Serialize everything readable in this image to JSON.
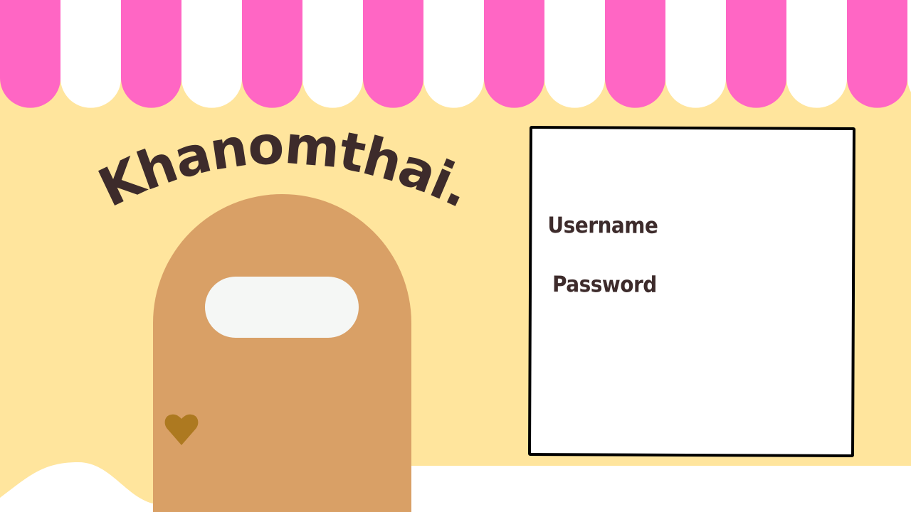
{
  "brand": {
    "title": "Khanomthai."
  },
  "login": {
    "username_label": "Username",
    "password_label": "Password"
  },
  "colors": {
    "awning_pink": "#ff66c4",
    "background": "#ffe59d",
    "door": "#d9a066",
    "window": "#f5f7f5",
    "heart": "#ad7920",
    "text": "#3d2b2b"
  },
  "icons": {
    "door_decoration": "heart-icon"
  }
}
